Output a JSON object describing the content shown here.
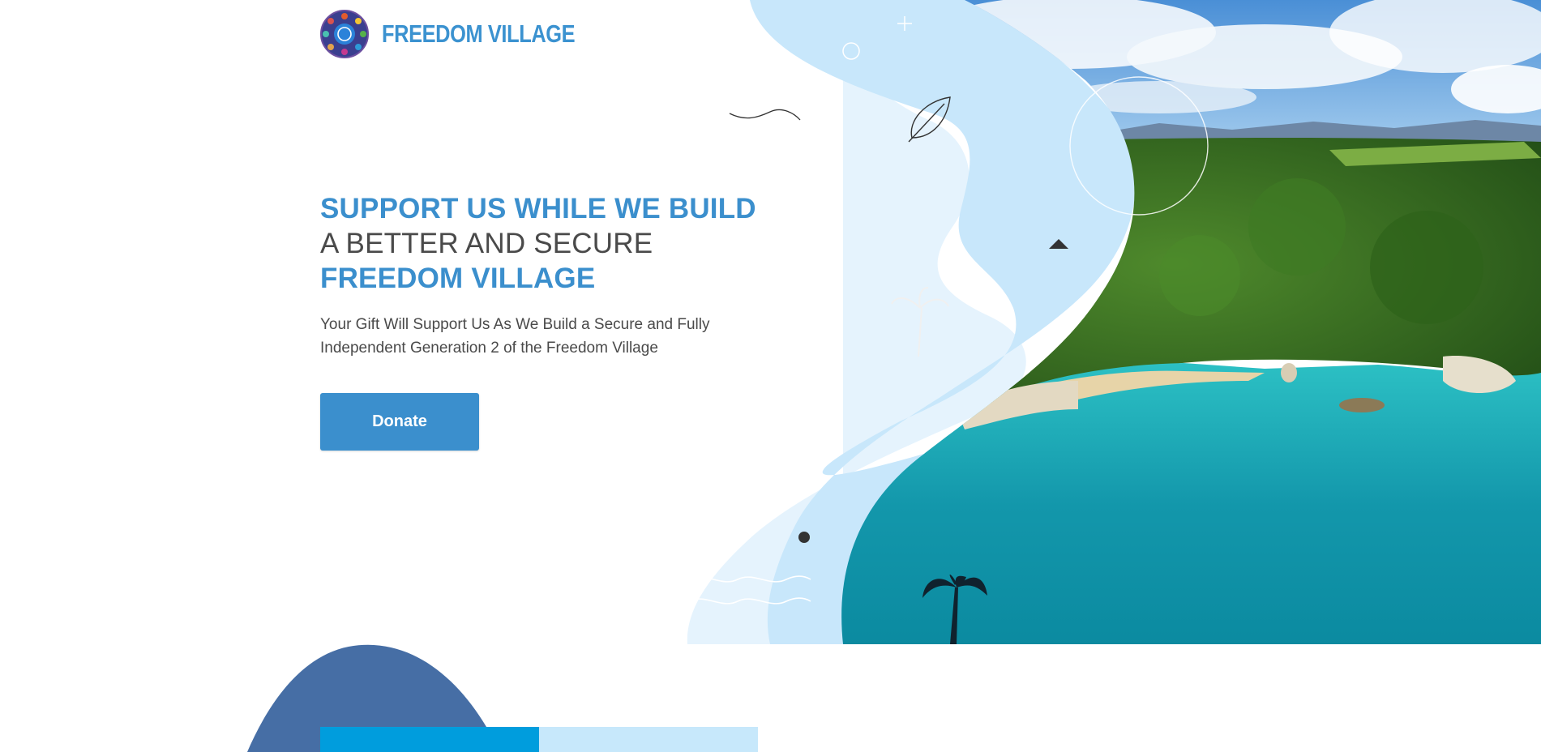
{
  "brand": {
    "name": "FREEDOM VILLAGE",
    "logo_icon": "freedom-village-globe-logo",
    "color": "#3b92d0"
  },
  "hero": {
    "headline_line1": "SUPPORT US WHILE WE BUILD",
    "headline_line2": "A BETTER AND SECURE",
    "headline_line3": "FREEDOM VILLAGE",
    "subtitle": "Your Gift Will Support Us As We Build a Secure and Fully Independent Generation 2 of the Freedom Village",
    "donate_label": "Donate",
    "image": "aerial-coastal-bay-photo"
  },
  "colors": {
    "accent": "#3b8fcd",
    "text_dark": "#4a4a4a",
    "wave_light": "#e5f3fd",
    "wave_mid": "#c8e7fb",
    "blob_dark": "#466ea5",
    "tab_blue": "#009ddd",
    "tab_light": "#c7e8fb"
  },
  "decorations": [
    "leaf-icon",
    "triangle-icon",
    "circle-icon",
    "plus-icon",
    "squiggle-icon",
    "palm-tree-icon",
    "dot-icon",
    "wave-lines-icon"
  ]
}
